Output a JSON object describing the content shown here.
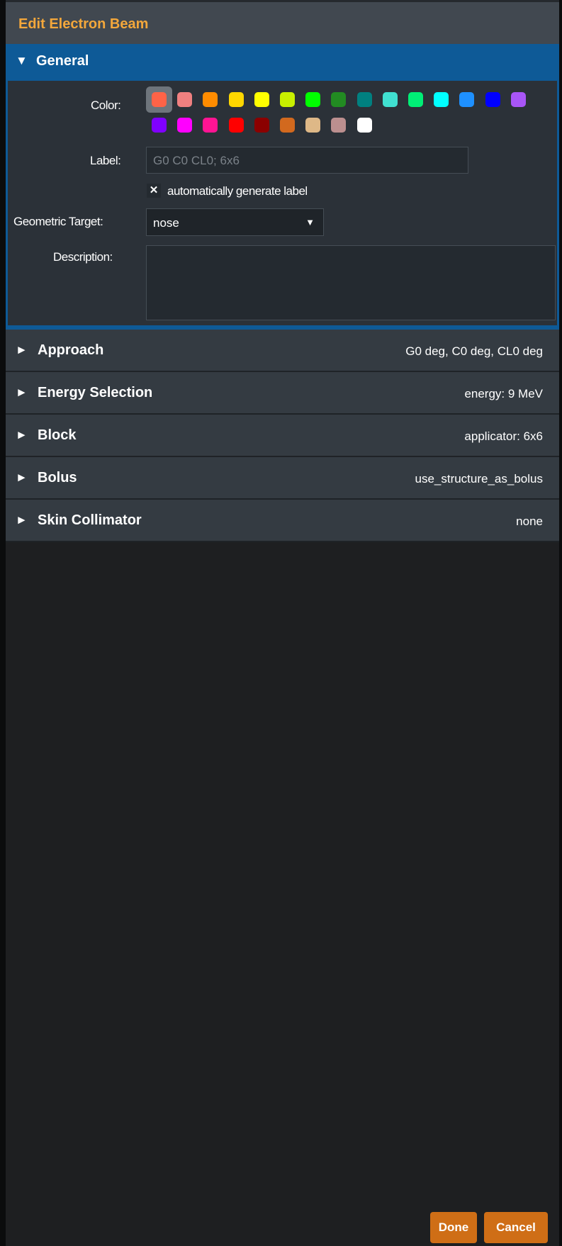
{
  "window": {
    "title": "Edit Electron Beam"
  },
  "general": {
    "header": "General",
    "color_label": "Color:",
    "label_label": "Label:",
    "label_value": "G0 C0 CL0; 6x6",
    "auto_label_checked": true,
    "auto_label_text": "automatically generate label",
    "geometric_target_label": "Geometric Target:",
    "geometric_target_value": "nose",
    "description_label": "Description:",
    "description_value": "",
    "colors": [
      {
        "hex": "#ff6347",
        "selected": true
      },
      {
        "hex": "#f08080"
      },
      {
        "hex": "#ff8c00"
      },
      {
        "hex": "#ffd700"
      },
      {
        "hex": "#ffff00"
      },
      {
        "hex": "#c8f000"
      },
      {
        "hex": "#00ff00"
      },
      {
        "hex": "#228b22"
      },
      {
        "hex": "#008080"
      },
      {
        "hex": "#40e0d0"
      },
      {
        "hex": "#00ee76"
      },
      {
        "hex": "#00ffff"
      },
      {
        "hex": "#1e90ff"
      },
      {
        "hex": "#0000ff"
      },
      {
        "hex": "#a855f7"
      },
      {
        "hex": "#8000ff"
      },
      {
        "hex": "#ff00ff"
      },
      {
        "hex": "#ff1493"
      },
      {
        "hex": "#ff0000"
      },
      {
        "hex": "#8b0000"
      },
      {
        "hex": "#d2691e"
      },
      {
        "hex": "#deb887"
      },
      {
        "hex": "#bc8f8f"
      },
      {
        "hex": "#ffffff"
      }
    ]
  },
  "sections": [
    {
      "label": "Approach",
      "summary": "G0 deg, C0 deg, CL0 deg"
    },
    {
      "label": "Energy Selection",
      "summary": "energy: 9 MeV"
    },
    {
      "label": "Block",
      "summary": "applicator: 6x6"
    },
    {
      "label": "Bolus",
      "summary": "use_structure_as_bolus"
    },
    {
      "label": "Skin Collimator",
      "summary": "none"
    }
  ],
  "buttons": {
    "done": "Done",
    "cancel": "Cancel"
  },
  "icons": {
    "expanded": "▼",
    "collapsed": "►",
    "dropdown": "▼",
    "check": "✕"
  },
  "theme": {
    "accent_title": "#f3a73b",
    "header_blue": "#0e5a97",
    "button_orange": "#cf6e16"
  }
}
